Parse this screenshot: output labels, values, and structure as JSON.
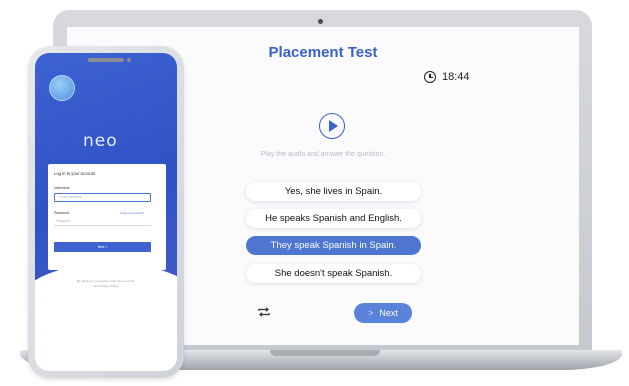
{
  "laptop": {
    "title": "Placement Test",
    "timer": "18:44",
    "instruction": "Play the audio and answer the question.",
    "answers": [
      {
        "label": "Yes, she lives in Spain.",
        "selected": false
      },
      {
        "label": "He speaks Spanish and English.",
        "selected": false
      },
      {
        "label": "They speak Spanish in Spain.",
        "selected": true
      },
      {
        "label": "She doesn't speak Spanish.",
        "selected": false
      }
    ],
    "next_label": "Next",
    "next_chevron": ">",
    "icons": {
      "timer": "clock-icon",
      "play": "play-icon",
      "repeat": "repeat-icon"
    },
    "colors": {
      "accent": "#3a62c9",
      "selected": "#4e76d1",
      "next": "#5b82db"
    }
  },
  "phone": {
    "logo": "neo",
    "login_title": "Log in to your account",
    "username_label": "Username",
    "username_placeholder": "Enter username",
    "password_label": "Password",
    "forgot_link": "Forgot password?",
    "password_placeholder": "Password",
    "signin_label": "Next >",
    "footer_line1": "By signing in you agree to the Terms of Use",
    "footer_line2": "and Privacy Policy",
    "colors": {
      "brand": "#3d62d2"
    }
  }
}
